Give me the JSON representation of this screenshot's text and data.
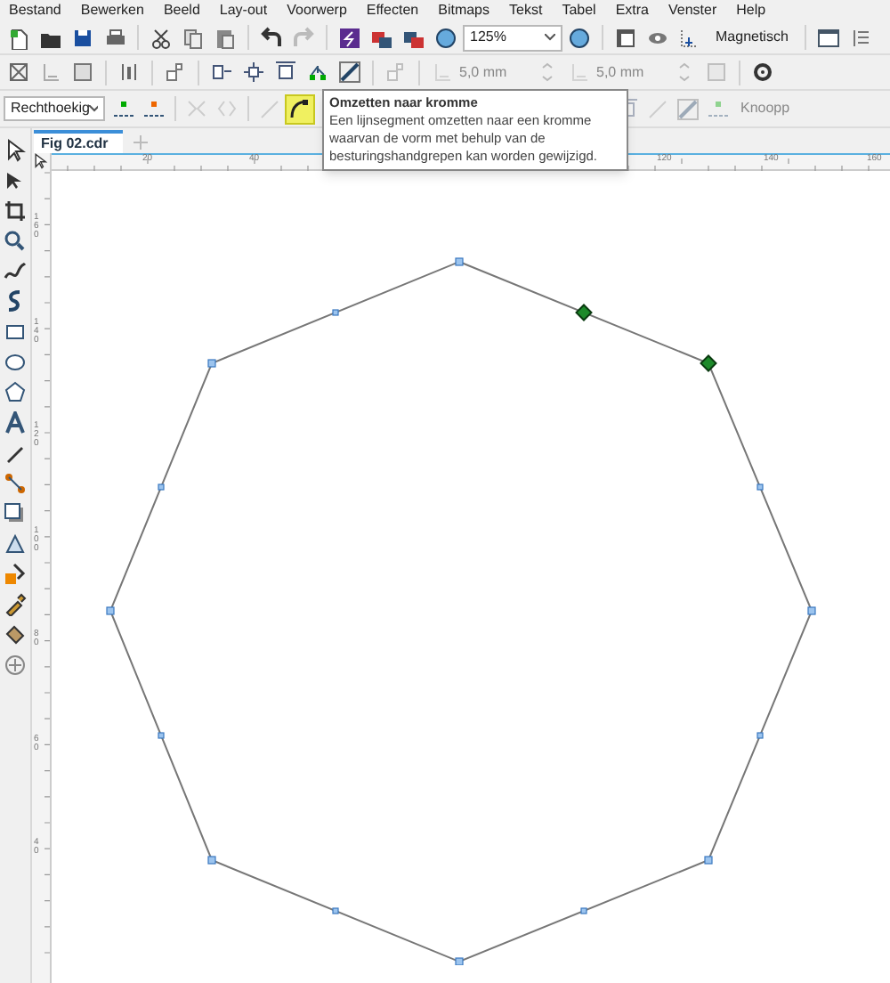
{
  "menu": [
    {
      "label": "Bestand"
    },
    {
      "label": "Bewerken"
    },
    {
      "label": "Beeld"
    },
    {
      "label": "Lay-out"
    },
    {
      "label": "Voorwerp"
    },
    {
      "label": "Effecten"
    },
    {
      "label": "Bitmaps"
    },
    {
      "label": "Tekst"
    },
    {
      "label": "Tabel"
    },
    {
      "label": "Extra"
    },
    {
      "label": "Venster"
    },
    {
      "label": "Help"
    }
  ],
  "zoom": {
    "value": "125%"
  },
  "snap": {
    "label": "Magnetisch"
  },
  "nudge": [
    {
      "value": "5,0 mm",
      "disabled": true
    },
    {
      "value": "5,0 mm",
      "disabled": true
    }
  ],
  "node_type": {
    "value": "Rechthoekig"
  },
  "node_buttons": [
    {
      "disabled": false,
      "selected": false
    },
    {
      "disabled": false,
      "selected": false
    },
    {
      "disabled": true,
      "selected": false
    },
    {
      "disabled": true,
      "selected": false
    },
    {
      "disabled": true,
      "selected": false
    },
    {
      "disabled": false,
      "selected": true
    }
  ],
  "node_more_label": "Knoopp",
  "document_tab": {
    "label": "Fig 02.cdr",
    "selected": true
  },
  "tooltip": {
    "title": "Omzetten naar kromme",
    "text": "Een lijnsegment omzetten naar een kromme waarvan de vorm met behulp van de besturingshandgrepen kan worden gewijzigd."
  },
  "ruler_h": [
    "20",
    "40",
    "120",
    "140",
    "160"
  ],
  "ruler_v": [
    "160",
    "140",
    "120",
    "100",
    "80",
    "60",
    "40"
  ],
  "nodes": [
    {
      "selected": false
    },
    {
      "selected": true
    },
    {
      "selected": true
    },
    {
      "selected": false
    },
    {
      "selected": false
    },
    {
      "selected": false
    },
    {
      "selected": false
    },
    {
      "selected": false
    },
    {
      "selected": false
    },
    {
      "selected": false
    },
    {
      "selected": false
    },
    {
      "selected": false
    },
    {
      "selected": false
    },
    {
      "selected": false
    },
    {
      "selected": false
    },
    {
      "selected": false
    }
  ]
}
